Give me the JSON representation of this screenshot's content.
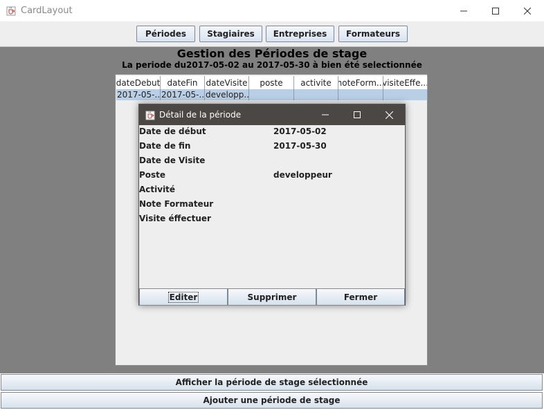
{
  "window": {
    "title": "CardLayout"
  },
  "toolbar": {
    "buttons": [
      "Périodes",
      "Stagiaires",
      "Entreprises",
      "Formateurs"
    ]
  },
  "main": {
    "heading": "Gestion des Périodes de stage",
    "subheading": "La periode du2017-05-02 au 2017-05-30 à bien été selectionnée"
  },
  "table": {
    "columns": [
      "dateDebut",
      "dateFin",
      "dateVisite",
      "poste",
      "activite",
      "noteForm...",
      "visiteEffe..."
    ],
    "rows": [
      [
        "2017-05-...",
        "2017-05-...",
        "developp...",
        "",
        "",
        "",
        ""
      ]
    ]
  },
  "dialog": {
    "title": "Détail de la période",
    "fields": [
      {
        "label": "Date de début",
        "value": "2017-05-02"
      },
      {
        "label": "Date de fin",
        "value": "2017-05-30"
      },
      {
        "label": "Date de Visite",
        "value": ""
      },
      {
        "label": "Poste",
        "value": "developpeur"
      },
      {
        "label": "Activité",
        "value": ""
      },
      {
        "label": "Note Formateur",
        "value": ""
      },
      {
        "label": "Visite éffectuer",
        "value": ""
      }
    ],
    "buttons": {
      "edit": "Editer",
      "delete": "Supprimer",
      "close": "Fermer"
    }
  },
  "bottom": {
    "show_button": "Afficher la période de stage sélectionnée",
    "add_button": "Ajouter une période de stage"
  },
  "colors": {
    "content_bg": "#808080",
    "selected_row": "#b8cfe5",
    "dialog_titlebar": "#4a4744"
  },
  "icons": [
    "java-cup-icon",
    "minimize-icon",
    "maximize-icon",
    "close-icon"
  ]
}
